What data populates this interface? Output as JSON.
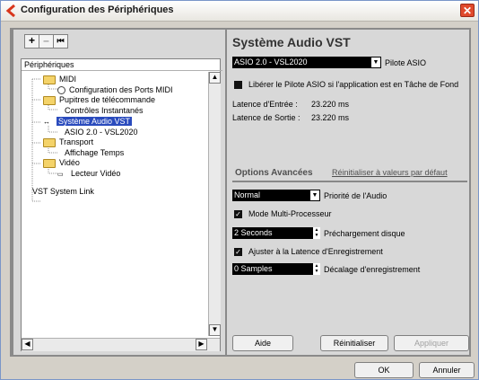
{
  "window": {
    "title": "Configuration des Périphériques",
    "close_symbol": "✕"
  },
  "toolbar": {
    "add": "+",
    "remove": "–",
    "reset": "⏮"
  },
  "tree": {
    "header": "Périphériques",
    "items": [
      {
        "label": "MIDI"
      },
      {
        "label": "Configuration des Ports MIDI"
      },
      {
        "label": "Pupitres de télécommande"
      },
      {
        "label": "Contrôles Instantanés"
      },
      {
        "label": "Système Audio VST"
      },
      {
        "label": "ASIO 2.0 - VSL2020"
      },
      {
        "label": "Transport"
      },
      {
        "label": "Affichage Temps"
      },
      {
        "label": "Vidéo"
      },
      {
        "label": "Lecteur Vidéo"
      },
      {
        "label": "VST System Link"
      }
    ]
  },
  "main": {
    "heading": "Système Audio VST",
    "driver_value": "ASIO 2.0 - VSL2020",
    "driver_label": "Pilote ASIO",
    "release_driver_label": "Libérer le Pilote ASIO si l'application est en Tâche de Fond",
    "input_latency_label": "Latence d'Entrée :",
    "input_latency_value": "23.220 ms",
    "output_latency_label": "Latence de Sortie :",
    "output_latency_value": "23.220 ms",
    "advanced_title": "Options Avancées",
    "reset_defaults_link": "Réinitialiser à valeurs par défaut",
    "priority_value": "Normal",
    "priority_label": "Priorité de l'Audio",
    "multiproc_label": "Mode Multi-Processeur",
    "preload_value": "2 Seconds",
    "preload_label": "Préchargement disque",
    "adjust_latency_label": "Ajuster à la Latence d'Enregistrement",
    "offset_value": "0 Samples",
    "offset_label": "Décalage d'enregistrement"
  },
  "buttons": {
    "help": "Aide",
    "reset": "Réinitialiser",
    "apply": "Appliquer",
    "ok": "OK",
    "cancel": "Annuler"
  }
}
